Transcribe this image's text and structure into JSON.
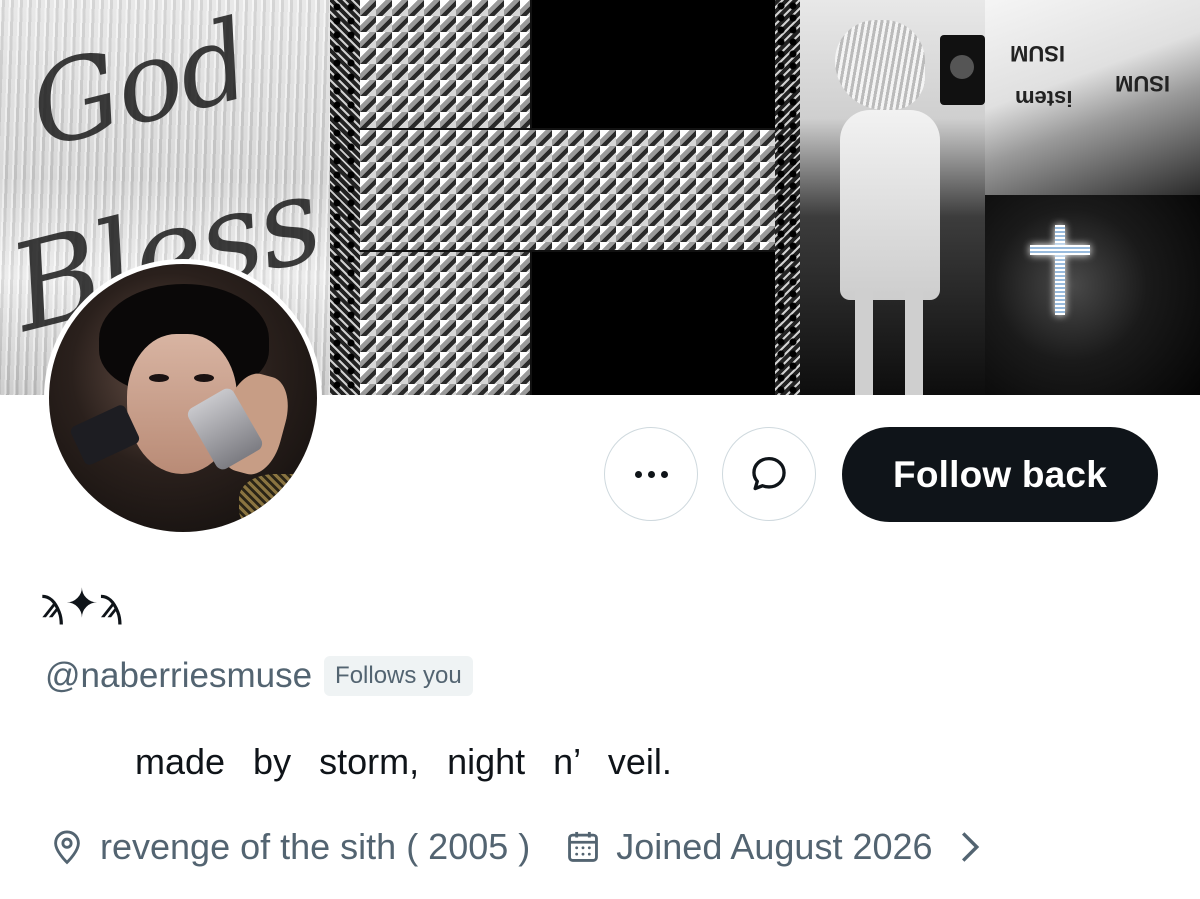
{
  "banner": {
    "hair_script": [
      "God",
      "Bless"
    ],
    "tights_text": [
      "ISUM",
      "istem",
      "ISUM"
    ]
  },
  "profile": {
    "display_name": "ϡ✦ϡ",
    "handle": "@naberriesmuse",
    "follows_you_badge": "Follows you",
    "bio": "made by storm, night n’ veil.",
    "location": "revenge of the sith ( 2005 )",
    "joined": "Joined August 2026"
  },
  "actions": {
    "follow_label": "Follow back"
  },
  "icons": {
    "more": "more-horizontal-icon",
    "message": "message-bubble-icon",
    "location": "location-pin-icon",
    "calendar": "calendar-icon",
    "chevron": "chevron-right-icon"
  },
  "colors": {
    "primary_text": "#0f1419",
    "secondary_text": "#536471",
    "follow_button_bg": "#0f1419",
    "badge_bg": "#eff3f4",
    "button_border": "#cfd9de"
  }
}
